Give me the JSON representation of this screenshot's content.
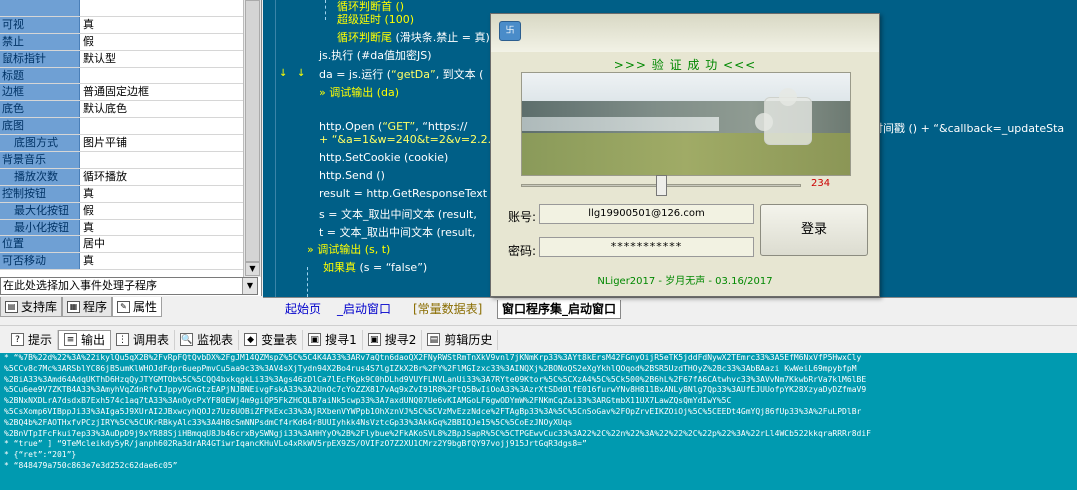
{
  "properties": [
    {
      "name": "",
      "value": "",
      "sub": false
    },
    {
      "name": "可视",
      "value": "真",
      "sub": false
    },
    {
      "name": "禁止",
      "value": "假",
      "sub": false
    },
    {
      "name": "鼠标指针",
      "value": "默认型",
      "sub": false
    },
    {
      "name": "标题",
      "value": "",
      "sub": false
    },
    {
      "name": "边框",
      "value": "普通固定边框",
      "sub": false
    },
    {
      "name": "底色",
      "value": "默认底色",
      "sub": false
    },
    {
      "name": "底图",
      "value": "",
      "sub": false
    },
    {
      "name": "底图方式",
      "value": "图片平铺",
      "sub": true
    },
    {
      "name": "背景音乐",
      "value": "",
      "sub": false
    },
    {
      "name": "播放次数",
      "value": "循环播放",
      "sub": true
    },
    {
      "name": "控制按钮",
      "value": "真",
      "sub": false
    },
    {
      "name": "最大化按钮",
      "value": "假",
      "sub": true
    },
    {
      "name": "最小化按钮",
      "value": "真",
      "sub": true
    },
    {
      "name": "位置",
      "value": "居中",
      "sub": false
    },
    {
      "name": "可否移动",
      "value": "真",
      "sub": false
    }
  ],
  "event_select": {
    "value": "在此处选择加入事件处理子程序"
  },
  "left_tabs": [
    {
      "label": "支持库",
      "icon": "library-icon",
      "active": false
    },
    {
      "label": "程序",
      "icon": "program-icon",
      "active": false
    },
    {
      "label": "属性",
      "icon": "properties-icon",
      "active": true
    }
  ],
  "code": {
    "line0": "循环判断首 ()",
    "line1": "超级延时 (100)",
    "line2a": "循环判断尾",
    "line2b": " (滑块条.禁止 = 真)",
    "line3": "js.执行 (#da值加密JS)",
    "line4a": "da = js.运行 (",
    "line4b": "“getDa”",
    "line4c": ", 到文本 (",
    "line5": "调试输出 (da)",
    "line6a": "http.Open (",
    "line6b": "“GET”",
    "line6c": ", “https://",
    "line6d": "取现行时间戳 () + “&callback=_updateSta",
    "line6e": "+ “&a=1&w=240&t=2&v=2.2.2”",
    "line7": "http.SetCookie (cookie)",
    "line8": "http.Send ()",
    "line9": "result = http.GetResponseText ()",
    "line10": "s = 文本_取出中间文本 (result,",
    "line11": "t = 文本_取出中间文本 (result,",
    "line12": "调试输出 (s, t)",
    "line13a": "如果真",
    "line13b": " (s = “false”)"
  },
  "editor_tabs": [
    {
      "label": "起始页",
      "active": false
    },
    {
      "label": "_启动窗口",
      "active": false
    },
    {
      "label": "[常量数据表]",
      "active": false
    },
    {
      "label": "窗口程序集_启动窗口",
      "active": true
    }
  ],
  "bottom_tabs": [
    {
      "label": "提示",
      "icon": "hint-icon",
      "active": false
    },
    {
      "label": "输出",
      "icon": "output-icon",
      "active": true
    },
    {
      "label": "调用表",
      "icon": "call-table-icon",
      "active": false
    },
    {
      "label": "监视表",
      "icon": "watch-icon",
      "active": false
    },
    {
      "label": "变量表",
      "icon": "variables-icon",
      "active": false
    },
    {
      "label": "搜寻1",
      "icon": "search-1-icon",
      "active": false
    },
    {
      "label": "搜寻2",
      "icon": "search-2-icon",
      "active": false
    },
    {
      "label": "剪辑历史",
      "icon": "clip-history-icon",
      "active": false
    }
  ],
  "output_lines": [
    "* “%7B%22d%22%3A%22ikylQu5qX2B%2FvRpFQtQvbDX%2FgJM14QZMspZ%5C%5C4K4A33%3ARv7aQtn6daoQX2FNyRWStRmTnXkV9vnl7jKNmKrp33%3AYt8kErsM42FGnyOijR5eTK5jddFdNywX2TEmrc33%3A5EfM6NxVfP5HwxCly",
    "%5CCv8c7Mc%3ARSblYC86jB5umKlWHOJdFdpr6uepPmvCu5aa9c33%3AV4sXjTydn94X2Bo4rus4S7lgIZkX2Br%2FY%2FlMGIzxc33%3AINQXj%2BONoQS2eXgYkhlQOqod%2BSR5UzdTHOyZ%2Bc33%3AbBAazi KwWeiL69mpybfpM",
    "%2BiA33%3Amd64AdqUKThD6HzqQyJTYGMTOb%5C%5CQQ4bxkqgkLi33%3Ags46zDlCa7lEcFKpk9C0hDLhd9VUYFLNVLanUi33%3A7RYte09Ktor%5C%5CXzA4%5C%5Ck500%2B6hL%2F67fA6CAtwhvc33%3AVvNm7KkwbRrVa7klM6lBE",
    "%5Cu6ee9V7ZKTB4A33%3AmyhVqZdnRfvIJppyVGnGtzEAPjNJBNEivgFskA33%3A2UnOc7cYoZZX817vAq9xZvI91R8%2FtQ5BwIiOoA33%3AzrXtSDd0lfE016furwYNv8H811BxANLy8Nlg7Qp33%3AUfEJUUofpYK28XzyaDyDZfmaV9",
    "%2BNxNXDLrA7dsdxB7Exh574c1aq7tA33%3AnOycPxYF80EWj4m9giQP5FkZHCQLB7aiNk5cwp33%3A7axdUNQ07Ue6vKIAMGoLF6gwODYmW%2FNKmCqZai33%3ARGtmbX11UX7LawZQsQmYdIwY%5C",
    "%5CsXomp6VIBppJi33%3AIga5J9XUrAI2JBxwcyhQOJz7Uz6UOBiZFPkExc33%3AjRXbenVYWPpb1OhXznVJ%5C%5CVzMvEzzNdce%2FTAgBp33%3A%5C%5CnSoGav%2FOpZrvEIKZOiOj%5C%5CEEDt4GmYQj86fUp33%3A%2FuLPDlBr",
    "%2BQ4b%2FAOTHxfvPCzjIRY%5C%5CUKrRBkyAlc33%3A4H8cSmNNPsdmCf4rKd64r8UUIyhkk4NsVztcGp33%3AkkGq%2BBIQJe15%5C%5CoEzJNOyXUqs",
    "%2BnVTpIFcFkui7ep33%3AuDpD9j9xYR88SjiHBmqqU8Jb46crxBySWNgji33%3AHHYyO%2B%2Flybue%2FkAKoSVL8%2BpJSapR%5C%5CTPGEwvCuc33%3A22%2C%22n%22%3A%22%22%2C%22p%22%3A%22rLl4WCb522kkqraRRRr8diF",
    "* “true” ] “9TeMcleikdy5yR/janph602Ra3drAR4GTiwrIqancKHuVLo4xRkWV5rpEX9ZS/OVIFzO7Z2XU1CMrz2Y9bgBfQY97vojj915JrtGqR3dgs8=”",
    "* {“ret”:“201”}",
    "* “848479a750c863e7e3d252c62dae6c05”"
  ],
  "login": {
    "heading": ">>> 验 证 成 功 <<<",
    "app_icon": "app-icon",
    "slider": {
      "value": "234",
      "fraction": 0.5
    },
    "account_label": "账号:",
    "account_value": "llg19900501@126.com",
    "password_label": "密码:",
    "password_value": "***********",
    "login_label": "登录",
    "footer": "NLiger2017 - 岁月无声 - 03.16/2017"
  }
}
